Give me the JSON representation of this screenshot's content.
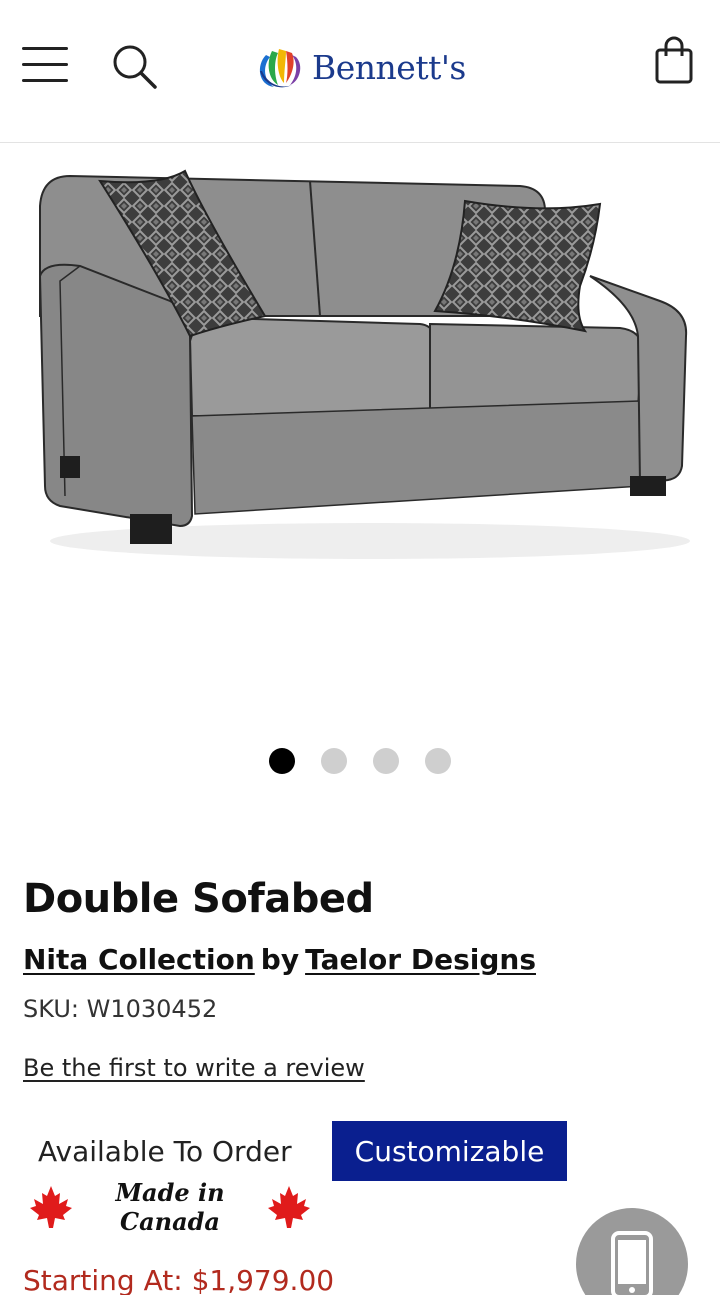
{
  "header": {
    "menu_icon": "hamburger-menu-icon",
    "search_icon": "search-icon",
    "logo_text": "Bennett's",
    "cart_icon": "shopping-bag-icon"
  },
  "gallery": {
    "image": "grey fabric double sofabed with two patterned pillows",
    "slide_count": 4,
    "active_slide": 1
  },
  "product": {
    "title": "Double Sofabed",
    "collection": "Nita Collection",
    "by": "by",
    "brand": "Taelor Designs",
    "sku": "SKU: W1030452",
    "review_link": "Be the first to write a review",
    "availability": "Available To Order",
    "customizable": "Customizable",
    "made_in": "Made in Canada",
    "price": "Starting At: $1,979.00"
  },
  "colors": {
    "accent_blue": "#0a1f8f",
    "price_red": "#b22a1e",
    "logo_blue": "#1b3a8c",
    "maple_red": "#e01b1b"
  },
  "fab": {
    "icon": "mobile-phone-icon"
  }
}
